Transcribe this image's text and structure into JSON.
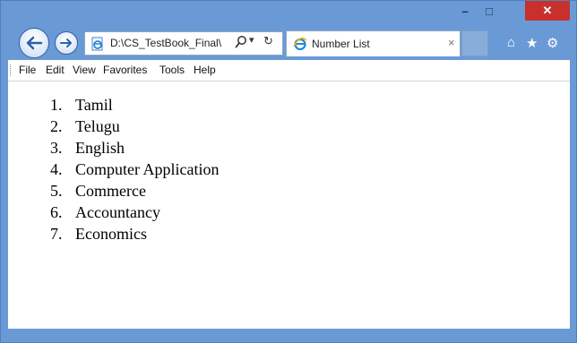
{
  "window": {
    "minimize_glyph": "–",
    "maximize_glyph": "□",
    "close_glyph": "✕"
  },
  "nav": {
    "back_icon": "left-arrow",
    "forward_icon": "right-arrow",
    "address": "D:\\CS_TestBook_Final\\",
    "search_glyph": "⚲",
    "dropdown_glyph": "▾",
    "refresh_glyph": "↻",
    "tab_title": "Number List",
    "tab_close": "×",
    "home_glyph": "⌂",
    "favorites_glyph": "★",
    "tools_glyph": "⚙"
  },
  "menu": [
    {
      "label": "File"
    },
    {
      "label": "Edit"
    },
    {
      "label": "View"
    },
    {
      "label": "Favorites"
    },
    {
      "label": "Tools"
    },
    {
      "label": "Help"
    }
  ],
  "list": [
    {
      "num": "1.",
      "text": "Tamil"
    },
    {
      "num": "2.",
      "text": "Telugu"
    },
    {
      "num": "3.",
      "text": "English"
    },
    {
      "num": "4.",
      "text": "Computer Application"
    },
    {
      "num": "5.",
      "text": "Commerce"
    },
    {
      "num": "6.",
      "text": "Accountancy"
    },
    {
      "num": "7.",
      "text": "Economics"
    }
  ],
  "colors": {
    "frame": "#6a9ad6",
    "close_button": "#c7302b",
    "ie_logo": "#1e88d8"
  }
}
